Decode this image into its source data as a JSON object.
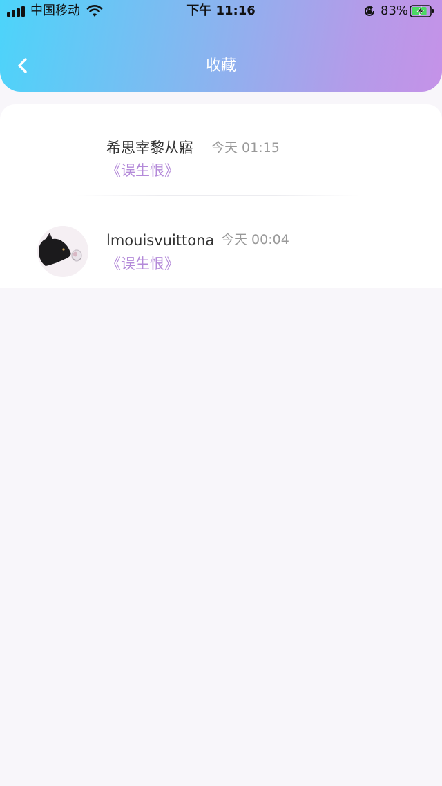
{
  "status_bar": {
    "carrier": "中国移动",
    "time": "下午 11:16",
    "battery_percent": "83%",
    "battery_level": 0.83,
    "icons": [
      "signal-icon",
      "wifi-icon",
      "rotation-lock-icon",
      "battery-charging-icon"
    ]
  },
  "header": {
    "title": "收藏",
    "back_icon": "chevron-left-icon",
    "gradient": [
      "#4cd4fa",
      "#c592e8"
    ]
  },
  "favorites": [
    {
      "username": "希思宰黎从寤",
      "timestamp": "今天 01:15",
      "book_title": "《误生恨》",
      "avatar": "blank"
    },
    {
      "username": "lmouisvuittona",
      "timestamp": "今天 00:04",
      "book_title": "《误生恨》",
      "avatar": "black-cat"
    }
  ],
  "colors": {
    "accent": "#b48ad9",
    "text_primary": "#333333",
    "text_secondary": "#999999",
    "background": "#f8f6fa"
  }
}
